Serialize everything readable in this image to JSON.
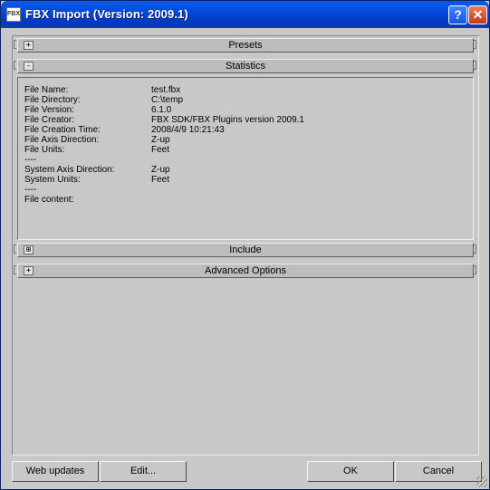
{
  "window": {
    "title": "FBX Import (Version: 2009.1)",
    "icon_label": "FBX",
    "help_button": "?",
    "close_button": "✕"
  },
  "rollouts": {
    "presets": {
      "toggle": "+",
      "label": "Presets"
    },
    "statistics": {
      "toggle": "-",
      "label": "Statistics"
    },
    "include": {
      "toggle": "⊞",
      "label": "Include"
    },
    "advanced": {
      "toggle": "+",
      "label": "Advanced Options"
    }
  },
  "statistics": {
    "rows": [
      {
        "key": "File Name:",
        "value": "test.fbx"
      },
      {
        "key": "File Directory:",
        "value": "C:\\temp"
      },
      {
        "key": "File Version:",
        "value": "6.1.0"
      },
      {
        "key": "File Creator:",
        "value": "FBX SDK/FBX Plugins version 2009.1"
      },
      {
        "key": "File Creation Time:",
        "value": "2008/4/9  10:21:43"
      },
      {
        "key": "File Axis Direction:",
        "value": "Z-up"
      },
      {
        "key": "File Units:",
        "value": "Feet"
      },
      {
        "key": "----",
        "value": ""
      },
      {
        "key": "System Axis Direction:",
        "value": "Z-up"
      },
      {
        "key": "System Units:",
        "value": "Feet"
      },
      {
        "key": "----",
        "value": ""
      },
      {
        "key": "File content:",
        "value": ""
      }
    ]
  },
  "buttons": {
    "web_updates": "Web updates",
    "edit": "Edit...",
    "ok": "OK",
    "cancel": "Cancel"
  }
}
